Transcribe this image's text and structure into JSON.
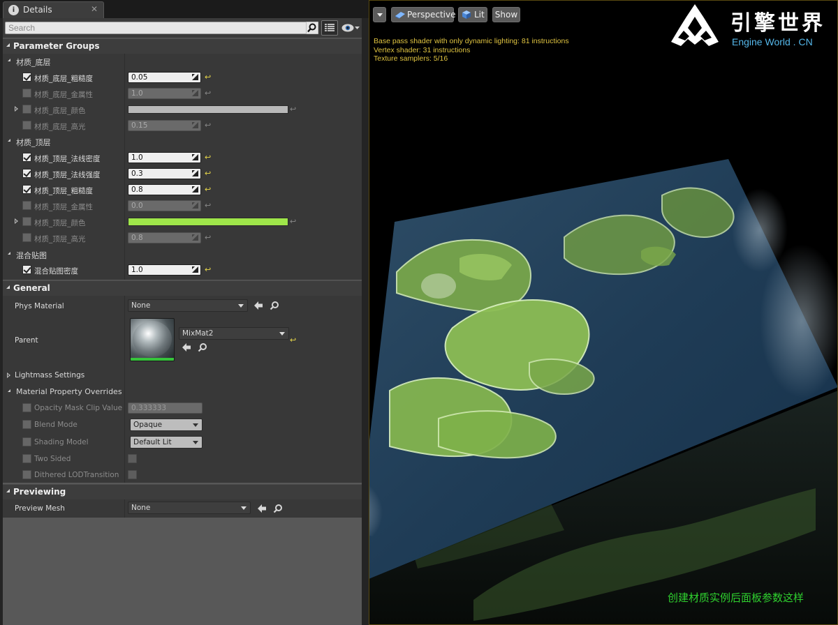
{
  "tab": {
    "title": "Details"
  },
  "search": {
    "placeholder": "Search"
  },
  "sections": {
    "param_groups": "Parameter Groups",
    "general": "General",
    "previewing": "Previewing"
  },
  "groups": {
    "base": "材质_底层",
    "top": "材质_顶层",
    "blend": "混合贴图"
  },
  "base_params": [
    {
      "label": "材质_底层_粗糙度",
      "value": "0.05",
      "enabled": true
    },
    {
      "label": "材质_底层_金属性",
      "value": "1.0",
      "enabled": false
    },
    {
      "label": "材质_底层_颜色",
      "enabled": false,
      "color": "#b9b9b9"
    },
    {
      "label": "材质_底层_高光",
      "value": "0.15",
      "enabled": false
    }
  ],
  "top_params": [
    {
      "label": "材质_顶层_法线密度",
      "value": "1.0",
      "enabled": true
    },
    {
      "label": "材质_顶层_法线强度",
      "value": "0.3",
      "enabled": true
    },
    {
      "label": "材质_顶层_粗糙度",
      "value": "0.8",
      "enabled": true
    },
    {
      "label": "材质_顶层_金属性",
      "value": "0.0",
      "enabled": false
    },
    {
      "label": "材质_顶层_颜色",
      "enabled": false,
      "color": "#9fe64a"
    },
    {
      "label": "材质_顶层_高光",
      "value": "0.8",
      "enabled": false
    }
  ],
  "blend_params": [
    {
      "label": "混合贴图密度",
      "value": "1.0",
      "enabled": true
    }
  ],
  "general": {
    "phys_material_label": "Phys Material",
    "phys_material_value": "None",
    "parent_label": "Parent",
    "parent_value": "MixMat2",
    "lightmass_label": "Lightmass Settings",
    "overrides_label": "Material Property Overrides",
    "opacity_label": "Opacity Mask Clip Value",
    "opacity_value": "0.333333",
    "blend_mode_label": "Blend Mode",
    "blend_mode_value": "Opaque",
    "shading_label": "Shading Model",
    "shading_value": "Default Lit",
    "two_sided_label": "Two Sided",
    "dithered_label": "Dithered LODTransition"
  },
  "previewing": {
    "mesh_label": "Preview Mesh",
    "mesh_value": "None"
  },
  "viewport": {
    "perspective": "Perspective",
    "lit": "Lit",
    "show": "Show",
    "stats": [
      "Base pass shader with only dynamic lighting: 81 instructions",
      "Vertex shader: 31 instructions",
      "Texture samplers: 5/16"
    ],
    "logo_text": "引擎世界",
    "logo_sub": "Engine World . CN",
    "caption": "创建材质实例后面板参数这样"
  },
  "colors": {
    "reset_arrow": "#e8d84a",
    "caption_green": "#2fd12f",
    "logo_blue": "#55b7ea"
  }
}
